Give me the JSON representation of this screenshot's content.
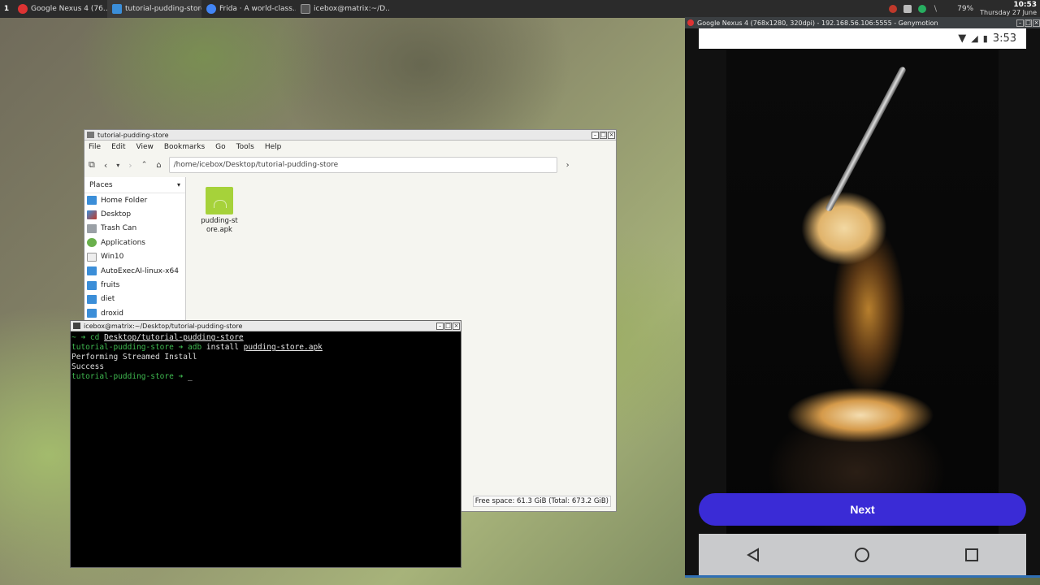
{
  "taskbar": {
    "workspace": "1",
    "tasks": [
      {
        "label": "Google Nexus 4 (76...",
        "icon": "genymotion-icon",
        "color": "#e0e0e0"
      },
      {
        "label": "tutorial-pudding-store",
        "icon": "folder-icon",
        "color": "#3b8ed8"
      },
      {
        "label": "Frida · A world-class...",
        "icon": "chrome-icon",
        "color": "#4285f4"
      },
      {
        "label": "icebox@matrix:~/D...",
        "icon": "terminal-icon",
        "color": "#555555"
      }
    ],
    "battery": "79%",
    "time": "10:53",
    "date": "Thursday 27 June"
  },
  "file_manager": {
    "title": "tutorial-pudding-store",
    "menu": [
      "File",
      "Edit",
      "View",
      "Bookmarks",
      "Go",
      "Tools",
      "Help"
    ],
    "address": "/home/icebox/Desktop/tutorial-pudding-store",
    "places_label": "Places",
    "places": [
      {
        "label": "Home Folder",
        "color": "#3b8ed8"
      },
      {
        "label": "Desktop",
        "color": "#5c6fc0"
      },
      {
        "label": "Trash Can",
        "color": "#9aa0a6"
      },
      {
        "label": "Applications",
        "color": "#6ab04c"
      },
      {
        "label": "Win10",
        "color": "#dddddd"
      },
      {
        "label": "AutoExecAI-linux-x64",
        "color": "#3b8ed8"
      },
      {
        "label": "fruits",
        "color": "#3b8ed8"
      },
      {
        "label": "diet",
        "color": "#3b8ed8"
      },
      {
        "label": "droxid",
        "color": "#3b8ed8"
      }
    ],
    "file": {
      "name": "pudding-store.apk"
    },
    "free_space": "Free space: 61.3 GiB (Total: 673.2 GiB)"
  },
  "terminal": {
    "title": "icebox@matrix:~/Desktop/tutorial-pudding-store",
    "lines": {
      "l1_prompt": "~ ➜ ",
      "l1_cmd": "cd ",
      "l1_arg": "Desktop/tutorial-pudding-store",
      "l2_prompt": "tutorial-pudding-store ➜ ",
      "l2_cmd": "adb",
      "l2_mid": " install ",
      "l2_arg": "pudding-store.apk",
      "l3": "Performing Streamed Install",
      "l4": "Success",
      "l5_prompt": "tutorial-pudding-store ➜ ",
      "cursor": "_"
    }
  },
  "emulator": {
    "title": "Google Nexus 4 (768x1280, 320dpi) - 192.168.56.106:5555 - Genymotion",
    "status_time": "3:53",
    "next_label": "Next",
    "accent": "#3a2bd6"
  }
}
